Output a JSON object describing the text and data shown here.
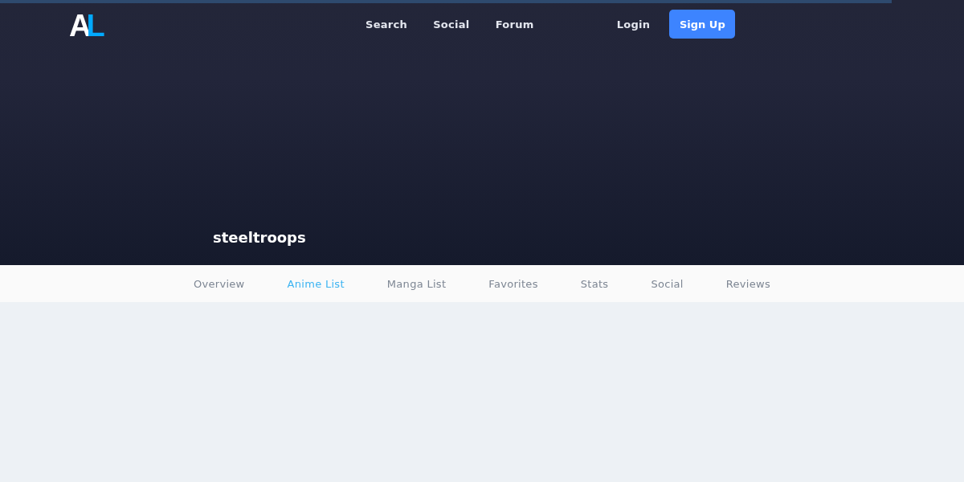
{
  "loading_bar": {
    "level": 0.925
  },
  "logo": {
    "letters": [
      "A",
      "L"
    ]
  },
  "nav": {
    "links": [
      "Search",
      "Social",
      "Forum"
    ],
    "login": "Login",
    "signup": "Sign Up"
  },
  "profile": {
    "username": "steeltroops"
  },
  "tabs": [
    {
      "label": "Overview",
      "selected": false
    },
    {
      "label": "Anime List",
      "selected": true
    },
    {
      "label": "Manga List",
      "selected": false
    },
    {
      "label": "Favorites",
      "selected": false
    },
    {
      "label": "Stats",
      "selected": false
    },
    {
      "label": "Social",
      "selected": false
    },
    {
      "label": "Reviews",
      "selected": false
    }
  ]
}
